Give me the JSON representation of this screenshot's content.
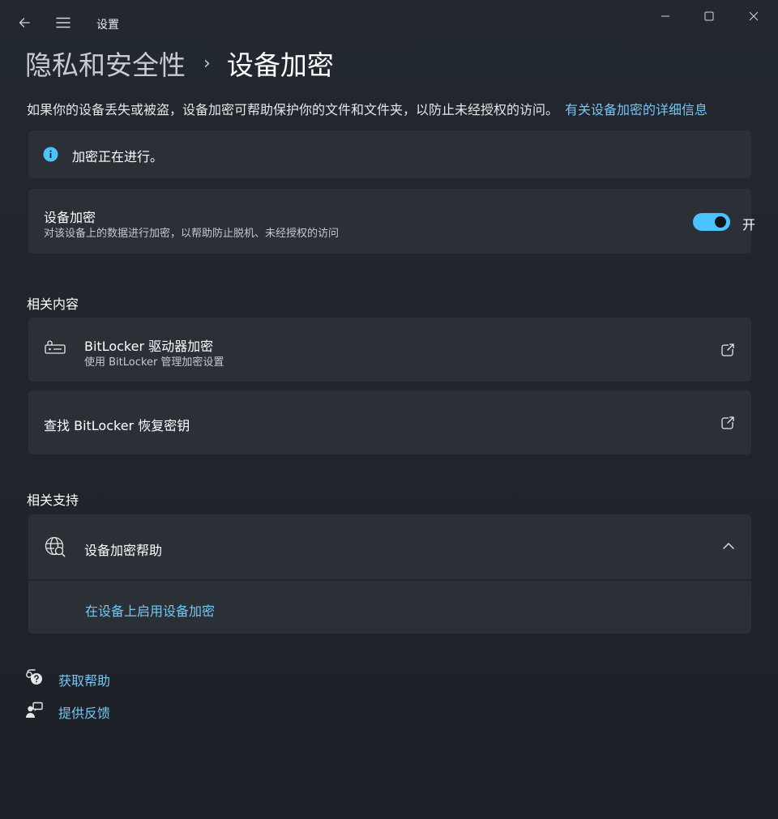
{
  "window": {
    "title": "设置",
    "back_icon": "back-arrow-icon",
    "menu_icon": "hamburger-menu-icon",
    "controls": [
      "minimize-icon",
      "maximize-icon",
      "close-icon"
    ]
  },
  "breadcrumb": {
    "parent": "隐私和安全性",
    "separator": "›",
    "current": "设备加密"
  },
  "description": {
    "text": "如果你的设备丢失或被盗，设备加密可帮助保护你的文件和文件夹，以防止未经授权的访问。",
    "link": "有关设备加密的详细信息"
  },
  "info_banner": {
    "icon": "info-icon",
    "text": "加密正在进行。",
    "accent": "#4cc2ff"
  },
  "encryption_card": {
    "title": "设备加密",
    "subtitle": "对该设备上的数据进行加密，以帮助防止脱机、未经授权的访问",
    "toggle_state": "开",
    "toggle_on": true,
    "accent": "#4cc2ff"
  },
  "related_content": {
    "heading": "相关内容",
    "items": [
      {
        "title": "BitLocker 驱动器加密",
        "subtitle": "使用 BitLocker 管理加密设置",
        "icon": "bitlocker-key-icon",
        "action_icon": "open-external-icon"
      },
      {
        "title": "查找 BitLocker 恢复密钥",
        "action_icon": "open-external-icon"
      }
    ]
  },
  "related_support": {
    "heading": "相关支持",
    "expander": {
      "title": "设备加密帮助",
      "icon": "globe-search-icon",
      "chevron": "chevron-up-icon",
      "link": "在设备上启用设备加密"
    }
  },
  "footer": {
    "get_help": "获取帮助",
    "feedback": "提供反馈"
  },
  "link_color": "#76c6f3"
}
